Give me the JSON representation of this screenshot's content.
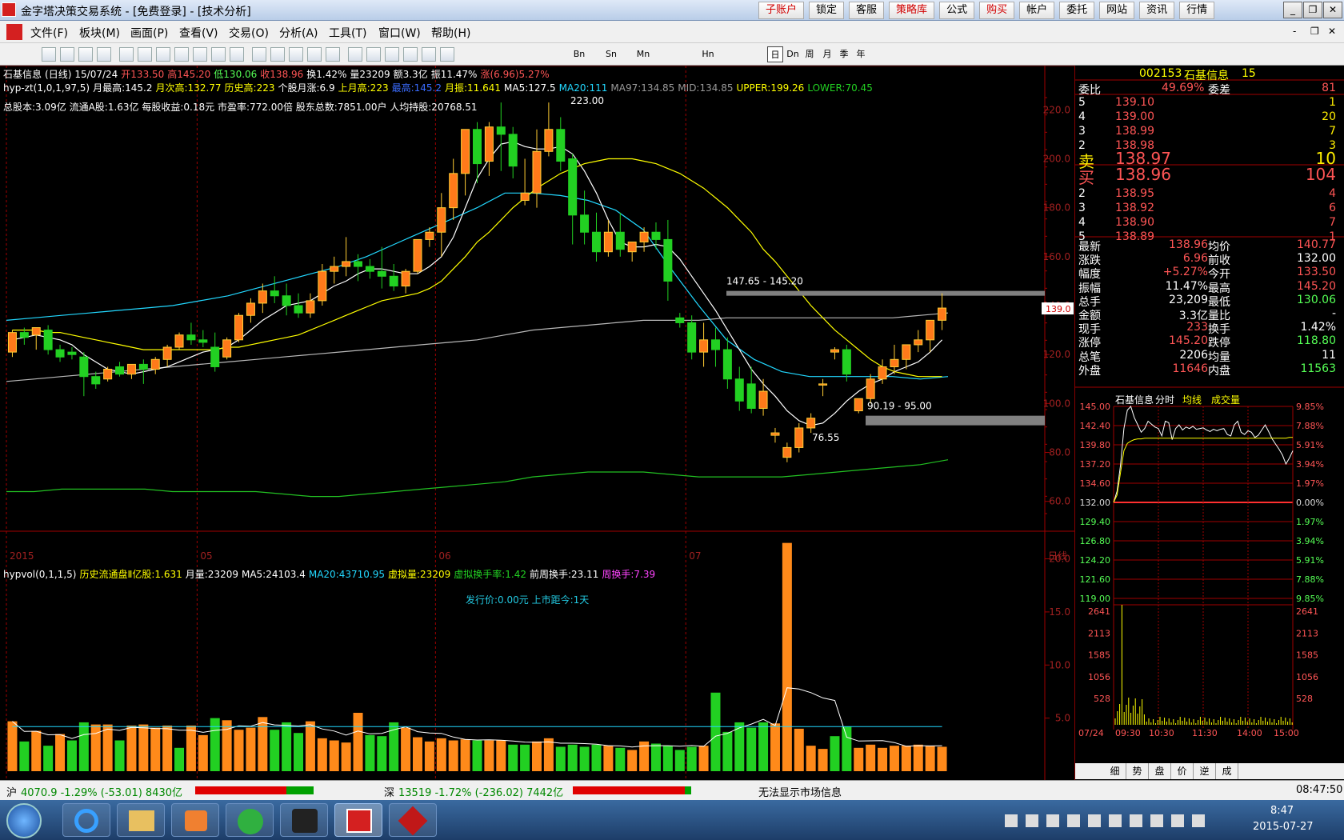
{
  "window": {
    "title": "金字塔决策交易系统 - [免费登录] - [技术分析]",
    "top_buttons": [
      {
        "label": "子账户",
        "red": true
      },
      {
        "label": "锁定",
        "red": false
      },
      {
        "label": "客服",
        "red": false
      },
      {
        "label": "策略库",
        "red": true
      },
      {
        "label": "公式",
        "red": false
      },
      {
        "label": "购买",
        "red": true
      },
      {
        "label": "帐户",
        "red": false
      },
      {
        "label": "委托",
        "red": false
      },
      {
        "label": "网站",
        "red": false
      },
      {
        "label": "资讯",
        "red": false
      },
      {
        "label": "行情",
        "red": false
      }
    ]
  },
  "menu": [
    "文件(F)",
    "板块(M)",
    "画面(P)",
    "查看(V)",
    "交易(O)",
    "分析(A)",
    "工具(T)",
    "窗口(W)",
    "帮助(H)"
  ],
  "toolbar_periods": [
    "Bn",
    "Sn",
    "Mn",
    "Hn",
    "日",
    "Dn",
    "周",
    "月",
    "季",
    "年"
  ],
  "chart": {
    "info1": {
      "name": "石基信息",
      "period": "(日线)",
      "date": "15/07/24",
      "open": "开133.50",
      "high": "高145.20",
      "low": "低130.06",
      "close": "收138.96",
      "turn": "换1.42%",
      "vol": "量23209",
      "amt": "额3.3亿",
      "amp": "振11.47%",
      "chg": "涨(6.96)5.27%"
    },
    "info2": {
      "formula": "hyp-zt(1,0,1,97,5)",
      "mhigh": "月最高:145.2",
      "mhigh2": "月次高:132.77",
      "hist": "历史高:223",
      "mrise": "个股月涨:6.9",
      "lmhigh": "上月高:223",
      "hi": "最高:145.2",
      "mamp": "月振:11.641",
      "ma5": "MA5:127.5",
      "ma20": "MA20:111",
      "ma97": "MA97:134.85",
      "mid": "MID:134.85",
      "upper": "UPPER:199.26",
      "lower": "LOWER:70.45"
    },
    "info3": "总股本:3.09亿 流通A股:1.63亿  每股收益:0.18元 市盈率:772.00倍 股东总数:7851.00户 人均持股:20768.51",
    "annotations": {
      "peak": "223.00",
      "low": "76.55",
      "range1": "147.65 - 145.20",
      "range2": "90.19 - 95.00",
      "cur": "139.0"
    },
    "xlabels": [
      {
        "t": "2015",
        "i": 0
      },
      {
        "t": "05",
        "i": 16
      },
      {
        "t": "06",
        "i": 36
      },
      {
        "t": "07",
        "i": 57
      }
    ],
    "period_label": "日线",
    "vol_info": {
      "formula": "hypvol(0,1,1,5)",
      "hist": "历史流通盘Ⅱ亿股:1.631",
      "mvol": "月量:23209",
      "ma5": "MA5:24103.4",
      "ma20": "MA20:43710.95",
      "vvol": "虚拟量:23209",
      "vturn": "虚拟换手率:1.42",
      "pturn": "前周换手:23.11",
      "wturn": "周换手:7.39"
    },
    "vol_note": "发行价:0.00元 上市距今:1天"
  },
  "chart_data": [
    {
      "type": "candlestick",
      "title": "石基信息 (日线)",
      "ylim": [
        55,
        225
      ],
      "yticks": [
        60,
        80,
        100,
        120,
        140,
        160,
        180,
        200,
        220
      ],
      "candles": [
        [
          121,
          130,
          119,
          129
        ],
        [
          129,
          131,
          124,
          127
        ],
        [
          128,
          131,
          122,
          131
        ],
        [
          130,
          132,
          120,
          122
        ],
        [
          122,
          124,
          117,
          119
        ],
        [
          121,
          123,
          118,
          120
        ],
        [
          119,
          121,
          103,
          111
        ],
        [
          111,
          113,
          106,
          108
        ],
        [
          110,
          115,
          109,
          114
        ],
        [
          115,
          117,
          111,
          112
        ],
        [
          112,
          116,
          110,
          116
        ],
        [
          116,
          118,
          108,
          114
        ],
        [
          114,
          119,
          112,
          118
        ],
        [
          118,
          124,
          115,
          123
        ],
        [
          123,
          129,
          122,
          128
        ],
        [
          128,
          133,
          124,
          126
        ],
        [
          126,
          130,
          123,
          125
        ],
        [
          123,
          129,
          113,
          115
        ],
        [
          119,
          127,
          118,
          126
        ],
        [
          126,
          137,
          125,
          136
        ],
        [
          136,
          143,
          133,
          141
        ],
        [
          141,
          149,
          137,
          146
        ],
        [
          146,
          152,
          141,
          144
        ],
        [
          144,
          149,
          136,
          140
        ],
        [
          140,
          145,
          135,
          137
        ],
        [
          137,
          145,
          135,
          142
        ],
        [
          142,
          157,
          140,
          154
        ],
        [
          154,
          160,
          149,
          156
        ],
        [
          156,
          168,
          152,
          158
        ],
        [
          158,
          161,
          150,
          156
        ],
        [
          156,
          159,
          151,
          154
        ],
        [
          154,
          164,
          147,
          152
        ],
        [
          152,
          157,
          146,
          148
        ],
        [
          148,
          155,
          145,
          154
        ],
        [
          154,
          166,
          153,
          167
        ],
        [
          167,
          172,
          164,
          170
        ],
        [
          170,
          186,
          160,
          180
        ],
        [
          180,
          200,
          175,
          194
        ],
        [
          194,
          210,
          185,
          212
        ],
        [
          212,
          215,
          190,
          198
        ],
        [
          199,
          215,
          193,
          213
        ],
        [
          213,
          223,
          195,
          210
        ],
        [
          210,
          213,
          192,
          197
        ],
        [
          183,
          200,
          181,
          186
        ],
        [
          186,
          212,
          180,
          203
        ],
        [
          203,
          223,
          201,
          212
        ],
        [
          212,
          217,
          195,
          199
        ],
        [
          200,
          202,
          165,
          177
        ],
        [
          177,
          187,
          165,
          170
        ],
        [
          170,
          178,
          158,
          162
        ],
        [
          162,
          175,
          160,
          170
        ],
        [
          170,
          178,
          160,
          163
        ],
        [
          162,
          166,
          158,
          166
        ],
        [
          166,
          172,
          162,
          170
        ],
        [
          170,
          174,
          163,
          167
        ],
        [
          167,
          175,
          142,
          150
        ],
        [
          135,
          137,
          131,
          133
        ],
        [
          133,
          136,
          118,
          121
        ],
        [
          121,
          133,
          115,
          126
        ],
        [
          126,
          131,
          115,
          122
        ],
        [
          122,
          127,
          106,
          110
        ],
        [
          110,
          115,
          97,
          101
        ],
        [
          108,
          115,
          96,
          98
        ],
        [
          98,
          110,
          95,
          105
        ],
        [
          87,
          90,
          84,
          88
        ],
        [
          78,
          84,
          76,
          82
        ],
        [
          82,
          92,
          80,
          90
        ],
        [
          90,
          96,
          88,
          94
        ],
        [
          108,
          110,
          103,
          108
        ],
        [
          121,
          123,
          118,
          122
        ],
        [
          122,
          124,
          109,
          112
        ],
        [
          97,
          100,
          96,
          102
        ],
        [
          102,
          112,
          100,
          110
        ],
        [
          110,
          118,
          108,
          115
        ],
        [
          115,
          124,
          112,
          118
        ],
        [
          118,
          124,
          114,
          124
        ],
        [
          124,
          130,
          121,
          126
        ],
        [
          126,
          134,
          121,
          134
        ],
        [
          134,
          145,
          130,
          139
        ]
      ],
      "mas": [
        {
          "name": "MA5",
          "color": "#ffffff",
          "v": [
            126,
            127,
            128,
            127,
            126,
            124,
            120,
            117,
            114,
            113,
            112,
            113,
            114,
            115,
            117,
            119,
            121,
            122,
            123,
            126,
            130,
            134,
            137,
            140,
            141,
            142,
            145,
            148,
            150,
            153,
            155,
            155,
            154,
            153,
            153,
            156,
            160,
            168,
            180,
            192,
            200,
            206,
            207,
            205,
            204,
            204,
            205,
            202,
            195,
            186,
            175,
            166,
            164,
            164,
            165,
            164,
            159,
            152,
            145,
            138,
            130,
            122,
            114,
            108,
            103,
            97,
            93,
            91,
            92,
            96,
            101,
            105,
            108,
            110,
            113,
            115,
            117,
            121,
            126
          ]
        },
        {
          "name": "MA20",
          "color": "#ffff00",
          "v": [
            130,
            130,
            130,
            129,
            129,
            128,
            127,
            126,
            125,
            124,
            123,
            122,
            122,
            122,
            122,
            122,
            122,
            122,
            123,
            123,
            124,
            125,
            126,
            127,
            128,
            130,
            132,
            134,
            136,
            138,
            140,
            142,
            143,
            144,
            145,
            147,
            150,
            155,
            160,
            166,
            170,
            175,
            180,
            184,
            188,
            191,
            194,
            196,
            198,
            199,
            200,
            200,
            200,
            199,
            198,
            196,
            194,
            191,
            188,
            184,
            180,
            175,
            170,
            163,
            158,
            152,
            146,
            140,
            135,
            130,
            126,
            122,
            118,
            115,
            113,
            112,
            111,
            111,
            111
          ]
        }
      ]
    },
    {
      "type": "bar",
      "title": "hypvol(0,1,1,5)",
      "ylim": [
        0,
        22
      ],
      "yticks": [
        5,
        10,
        15,
        20
      ],
      "values": [
        4.7,
        2.8,
        3.8,
        2.4,
        3.5,
        2.9,
        4.6,
        4.4,
        4.4,
        2.9,
        4.3,
        4.4,
        4.1,
        4.3,
        2.2,
        4.3,
        3.4,
        5.0,
        4.8,
        3.9,
        4.1,
        5.1,
        3.9,
        4.6,
        3.6,
        4.7,
        3.1,
        2.9,
        2.7,
        5.5,
        3.4,
        3.3,
        4.6,
        4.1,
        3.2,
        2.8,
        3.1,
        2.9,
        3.0,
        2.9,
        2.9,
        2.9,
        2.5,
        2.5,
        2.8,
        3.1,
        2.3,
        2.5,
        2.3,
        2.5,
        2.4,
        2.2,
        2.0,
        2.8,
        2.6,
        2.4,
        2.0,
        2.3,
        2.4,
        7.4,
        3.7,
        4.6,
        4.1,
        4.6,
        4.5,
        21.5,
        4.0,
        2.4,
        2.1,
        3.3,
        4.2,
        2.2,
        2.5,
        2.2,
        2.4,
        2.4,
        2.5,
        2.4,
        2.3
      ],
      "up": [
        1,
        0,
        1,
        0,
        1,
        0,
        0,
        1,
        1,
        0,
        1,
        1,
        1,
        1,
        0,
        1,
        1,
        0,
        1,
        1,
        1,
        1,
        0,
        0,
        0,
        1,
        1,
        1,
        1,
        1,
        0,
        0,
        0,
        1,
        1,
        1,
        1,
        1,
        1,
        0,
        1,
        1,
        0,
        0,
        1,
        1,
        0,
        0,
        0,
        0,
        1,
        0,
        1,
        1,
        0,
        0,
        0,
        0,
        1,
        0,
        0,
        0,
        0,
        0,
        1,
        1,
        1,
        1,
        1,
        0,
        0,
        1,
        1,
        1,
        1,
        1,
        1,
        1,
        1
      ]
    },
    {
      "type": "line",
      "title": "石基信息 分时",
      "ylim": [
        119,
        145
      ],
      "yticks_left": [
        "145.00",
        "142.40",
        "139.80",
        "137.20",
        "134.60",
        "132.00",
        "129.40",
        "126.80",
        "124.20",
        "121.60",
        "119.00"
      ],
      "yticks_right": [
        "9.85%",
        "7.88%",
        "5.91%",
        "3.94%",
        "1.97%",
        "0.00%",
        "1.97%",
        "3.94%",
        "5.91%",
        "7.88%",
        "9.85%"
      ],
      "price": [
        132.0,
        133.5,
        137.0,
        142.0,
        144.5,
        145.0,
        143.5,
        142.5,
        141.5,
        142.0,
        143.0,
        142.6,
        142.2,
        142.0,
        141.0,
        143.0,
        142.8,
        140.5,
        142.0,
        142.5,
        141.8,
        142.2,
        142.0,
        142.3,
        141.9,
        142.0,
        142.1,
        141.8,
        141.6,
        141.9,
        141.7,
        141.9,
        142.0,
        141.2,
        141.0,
        142.5,
        143.0,
        141.5,
        141.2,
        141.7,
        141.5,
        140.8,
        141.1,
        141.8,
        142.5,
        141.6,
        140.6,
        139.9,
        139.2,
        138.4,
        137.2,
        138.0,
        139.0
      ],
      "avg": [
        132.0,
        133.0,
        136.0,
        139.0,
        140.0,
        140.3,
        140.5,
        140.6,
        140.6,
        140.7,
        140.7,
        140.7,
        140.7,
        140.7,
        140.7,
        140.7,
        140.7,
        140.7,
        140.7,
        140.7,
        140.7,
        140.7,
        140.7,
        140.7,
        140.7,
        140.7,
        140.7,
        140.7,
        140.7,
        140.7,
        140.7,
        140.7,
        140.7,
        140.7,
        140.7,
        140.7,
        140.7,
        140.7,
        140.7,
        140.7,
        140.7,
        140.7,
        140.7,
        140.7,
        140.7,
        140.7,
        140.7,
        140.7,
        140.7,
        140.7,
        140.7,
        140.8,
        140.8
      ],
      "vol_ticks": [
        "2641",
        "2113",
        "1585",
        "1056",
        "528"
      ],
      "xlabels": [
        "07/24",
        "09:30",
        "10:30",
        "11:30",
        "14:00",
        "15:00"
      ],
      "legend": [
        "石基信息",
        "分时",
        "均线",
        "成交量"
      ]
    }
  ],
  "quote": {
    "code": "002153",
    "name": "石基信息",
    "num": "15",
    "weibi_l": "委比",
    "weibi": "49.69%",
    "weicha_l": "委差",
    "weicha": "81",
    "asks": [
      {
        "lv": "5",
        "p": "139.10",
        "v": "1"
      },
      {
        "lv": "4",
        "p": "139.00",
        "v": "20"
      },
      {
        "lv": "3",
        "p": "138.99",
        "v": "7"
      },
      {
        "lv": "2",
        "p": "138.98",
        "v": "3"
      },
      {
        "lv": "卖",
        "p": "138.97",
        "v": "10"
      }
    ],
    "bids": [
      {
        "lv": "买",
        "p": "138.96",
        "v": "104"
      },
      {
        "lv": "2",
        "p": "138.95",
        "v": "4"
      },
      {
        "lv": "3",
        "p": "138.92",
        "v": "6"
      },
      {
        "lv": "4",
        "p": "138.90",
        "v": "7"
      },
      {
        "lv": "5",
        "p": "138.89",
        "v": "1"
      }
    ],
    "stats": [
      [
        "最新",
        "138.96",
        "均价",
        "140.77",
        "#ff5555",
        "#ff5555"
      ],
      [
        "涨跌",
        "6.96",
        "前收",
        "132.00",
        "#ff5555",
        "#ffffff"
      ],
      [
        "幅度",
        "+5.27%",
        "今开",
        "133.50",
        "#ff5555",
        "#ff5555"
      ],
      [
        "振幅",
        "11.47%",
        "最高",
        "145.20",
        "#ffffff",
        "#ff5555"
      ],
      [
        "总手",
        "23,209",
        "最低",
        "130.06",
        "#ffffff",
        "#55ff55"
      ],
      [
        "金额",
        "3.3亿",
        "量比",
        "-",
        "#ffffff",
        "#ffffff"
      ],
      [
        "现手",
        "233",
        "换手",
        "1.42%",
        "#ff5555",
        "#ffffff"
      ],
      [
        "涨停",
        "145.20",
        "跌停",
        "118.80",
        "#ff5555",
        "#55ff55"
      ],
      [
        "总笔",
        "2206",
        "均量",
        "11",
        "#ffffff",
        "#ffffff"
      ],
      [
        "外盘",
        "11646",
        "内盘",
        "11563",
        "#ff5555",
        "#55ff55"
      ]
    ],
    "tabs": [
      "细",
      "势",
      "盘",
      "价",
      "逆",
      "成"
    ]
  },
  "status": {
    "sh_name": "沪",
    "sh": "4070.9 -1.29% (-53.01) 8430亿",
    "sz_name": "深",
    "sz": "13519 -1.72% (-236.02) 7442亿",
    "msg": "无法显示市场信息",
    "time": "08:47:50"
  },
  "taskbar": {
    "clock": "8:47",
    "date": "2015-07-27"
  }
}
